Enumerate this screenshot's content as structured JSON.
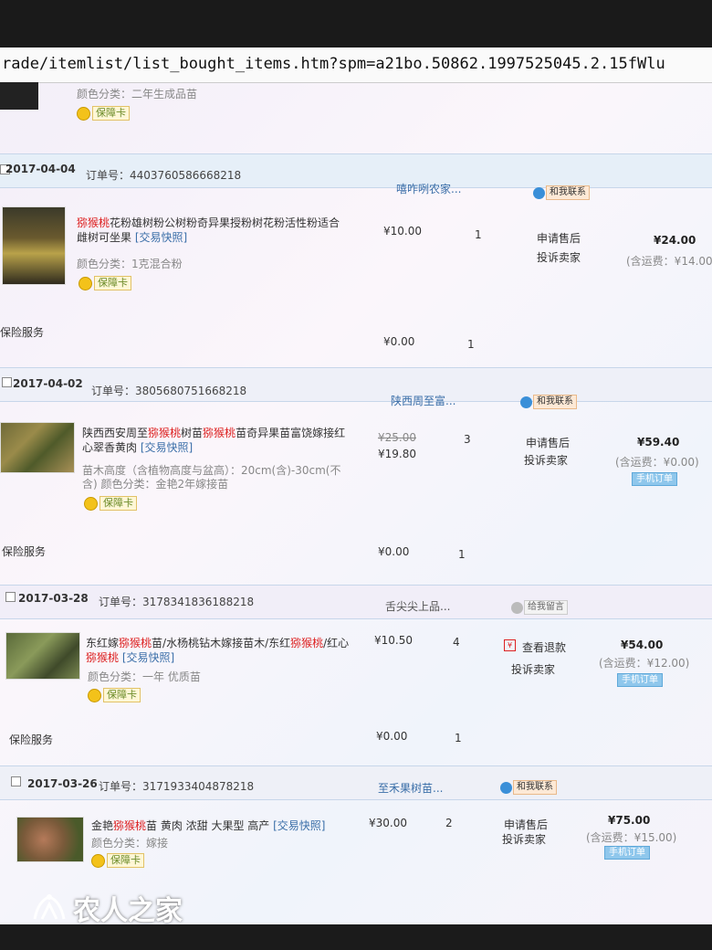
{
  "browser": {
    "url": "rade/itemlist/list_bought_items.htm?spm=a21bo.50862.1997525045.2.15fWlu"
  },
  "top_fragment": {
    "color_spec": "颜色分类：二年生成品苗",
    "badge_label": "保障卡"
  },
  "orders": [
    {
      "date": "2017-04-04",
      "order_no_label": "订单号：",
      "order_no": "4403760586668218",
      "shop": "嘻咋咧农家...",
      "contact_label": "和我联系",
      "item_title_hl": "猕猴桃",
      "item_title_rest": "花粉雄树粉公树粉奇异果授粉树花粉活性粉适合雌树可坐果",
      "trade_tag": "[交易快照]",
      "spec": "颜色分类：1克混合粉",
      "badge_label": "保障卡",
      "price": "¥10.00",
      "qty": "1",
      "action1": "申请售后",
      "action2": "投诉卖家",
      "total": "¥24.00",
      "shipping": "(含运费：¥14.00)",
      "insurance_label": "保险服务",
      "insurance_price": "¥0.00",
      "insurance_qty": "1"
    },
    {
      "date": "2017-04-02",
      "order_no_label": "订单号：",
      "order_no": "3805680751668218",
      "shop": "陕西周至富...",
      "contact_label": "和我联系",
      "item_title_pre": "陕西西安周至",
      "item_title_hl": "猕猴桃",
      "item_title_mid": "树苗",
      "item_title_hl2": "猕猴桃",
      "item_title_rest": "苗奇异果苗富饶嫁接红心翠香黄肉",
      "trade_tag": "[交易快照]",
      "spec": "苗木高度（含植物高度与盆高）：20cm(含)-30cm(不含) 颜色分类：金艳2年嫁接苗",
      "badge_label": "保障卡",
      "orig_price": "¥25.00",
      "price": "¥19.80",
      "qty": "3",
      "action1": "申请售后",
      "action2": "投诉卖家",
      "total": "¥59.40",
      "shipping": "(含运费：¥0.00)",
      "mobile_tag": "手机订单",
      "insurance_label": "保险服务",
      "insurance_price": "¥0.00",
      "insurance_qty": "1"
    },
    {
      "date": "2017-03-28",
      "order_no_label": "订单号：",
      "order_no": "3178341836188218",
      "shop": "舌尖尖上品...",
      "contact_label": "给我留言",
      "item_title_pre": "东红嫁",
      "item_title_hl": "猕猴桃",
      "item_title_mid": "苗/水杨桃钻木嫁接苗木/东红",
      "item_title_hl2": "猕猴桃",
      "item_title_rest": "/红心",
      "item_title_hl3": "猕猴桃",
      "trade_tag": "[交易快照]",
      "spec": "颜色分类：一年 优质苗",
      "badge_label": "保障卡",
      "price": "¥10.50",
      "qty": "4",
      "action1": "查看退款",
      "action2": "投诉卖家",
      "total": "¥54.00",
      "shipping": "(含运费：¥12.00)",
      "mobile_tag": "手机订单",
      "insurance_label": "保险服务",
      "insurance_price": "¥0.00",
      "insurance_qty": "1"
    },
    {
      "date": "2017-03-26",
      "order_no_label": "订单号：",
      "order_no": "3171933404878218",
      "shop": "至禾果树苗...",
      "contact_label": "和我联系",
      "item_title_pre": "金艳",
      "item_title_hl": "猕猴桃",
      "item_title_rest": "苗 黄肉 浓甜 大果型 高产",
      "trade_tag": "[交易快照]",
      "spec": "颜色分类：嫁接",
      "badge_label": "保障卡",
      "price": "¥30.00",
      "qty": "2",
      "action1": "申请售后",
      "action2": "投诉卖家",
      "total": "¥75.00",
      "shipping": "(含运费：¥15.00)",
      "mobile_tag": "手机订单"
    }
  ],
  "watermark": {
    "text": "农人之家"
  }
}
